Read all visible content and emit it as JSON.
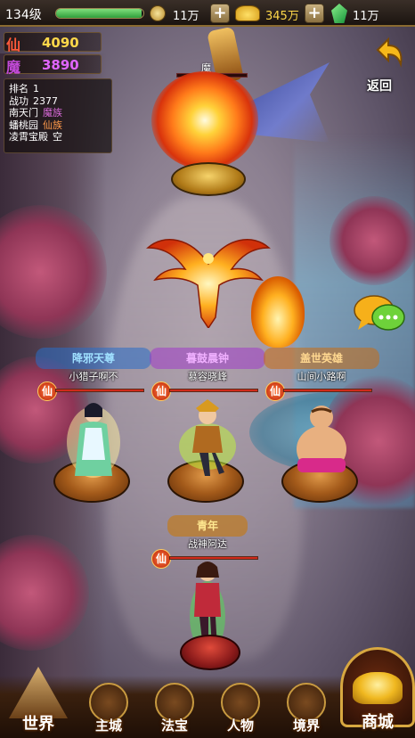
{
  "topbar": {
    "level": "134级",
    "xp_fraction": 0.98,
    "coins": "11万",
    "gold": "345万",
    "gems": "11万"
  },
  "factions": {
    "xian": {
      "symbol": "仙",
      "score": "4090",
      "color": "#ff5a3a"
    },
    "mo": {
      "symbol": "魔",
      "score": "3890",
      "color": "#c24ad8"
    }
  },
  "info": {
    "rank_label": "排名",
    "rank_value": "1",
    "merit_label": "战功",
    "merit_value": "2377",
    "rows": [
      {
        "place": "南天门",
        "owner": "魔族",
        "owner_color": "#d86ad8"
      },
      {
        "place": "蟠桃园",
        "owner": "仙族",
        "owner_color": "#ff9a4a"
      },
      {
        "place": "凌霄宝殿",
        "owner": "空",
        "owner_color": "#ffffff"
      }
    ]
  },
  "back_button": {
    "label": "返回"
  },
  "boss": {
    "name": "魔",
    "hp_fraction": 0.0
  },
  "allies": [
    {
      "title": "降邪天尊",
      "title_color": "#4aa8f0",
      "name": "小猎子啊不",
      "badge": "仙",
      "hp_fraction": 1.0
    },
    {
      "title": "暮鼓晨钟",
      "title_color": "#c25ae0",
      "name": "慕容晓峰",
      "badge": "仙",
      "hp_fraction": 1.0
    },
    {
      "title": "盖世英雄",
      "title_color": "#e08a2a",
      "name": "山间小路啊",
      "badge": "仙",
      "hp_fraction": 1.0
    }
  ],
  "player": {
    "title": "青年",
    "title_color": "#e0a02a",
    "name": "战神阿达",
    "badge": "仙",
    "hp_fraction": 1.0
  },
  "nav": {
    "world": "世界",
    "main_city": "主城",
    "treasure": "法宝",
    "character": "人物",
    "realm": "境界",
    "shop": "商城"
  },
  "icons": {
    "coin": "coin-icon",
    "gold": "gold-ingot-icon",
    "gem": "gem-icon",
    "back": "back-arrow-icon",
    "chat": "chat-bubbles-icon"
  }
}
